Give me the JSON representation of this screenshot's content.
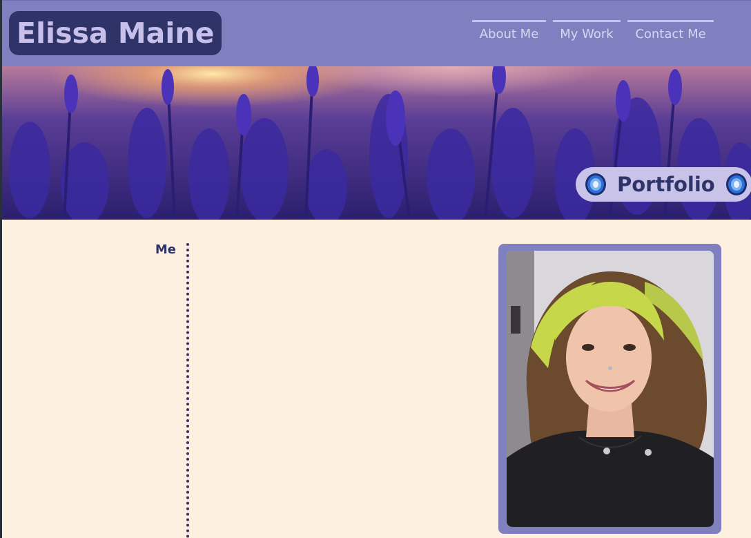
{
  "header": {
    "brand": "Elissa Maine",
    "nav": [
      {
        "label": "About Me"
      },
      {
        "label": "My Work"
      },
      {
        "label": "Contact Me"
      }
    ]
  },
  "banner": {
    "badge_label": "Portfolio",
    "badge_icon": "portal-icon"
  },
  "content": {
    "section_label": "Me",
    "photo_icon": "profile-photo"
  },
  "colors": {
    "header_bg": "#8080c0",
    "brand_bg": "#2e3368",
    "page_bg": "#fdf0e0",
    "accent_text": "#2e3368"
  }
}
